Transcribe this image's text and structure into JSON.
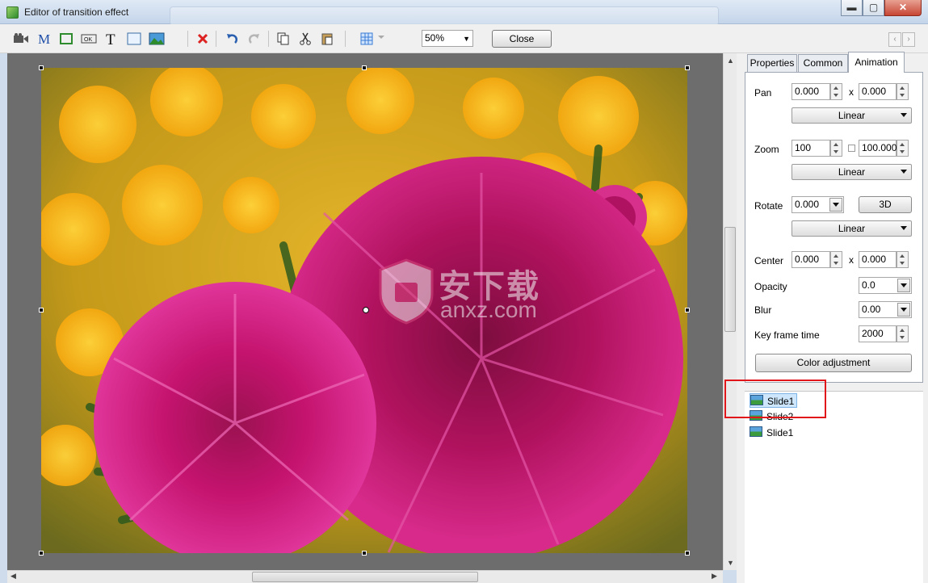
{
  "window": {
    "title": "Editor of transition effect",
    "minimize": "▬",
    "maximize": "▢",
    "close": "✕"
  },
  "toolbar": {
    "zoom_value": "50%",
    "close_label": "Close",
    "nav_prev": "‹",
    "nav_next": "›"
  },
  "tabs": {
    "properties": "Properties",
    "common": "Common",
    "animation": "Animation"
  },
  "animation": {
    "pan_label": "Pan",
    "pan_x": "0.000",
    "pan_sep": "x",
    "pan_y": "0.000",
    "pan_interp": "Linear",
    "zoom_label": "Zoom",
    "zoom_x": "100",
    "zoom_y": "100.000",
    "zoom_interp": "Linear",
    "rotate_label": "Rotate",
    "rotate_value": "0.000",
    "rotate_3d": "3D",
    "rotate_interp": "Linear",
    "center_label": "Center",
    "center_x": "0.000",
    "center_sep": "x",
    "center_y": "0.000",
    "opacity_label": "Opacity",
    "opacity_value": "0.0",
    "blur_label": "Blur",
    "blur_value": "0.00",
    "keyframe_label": "Key frame time",
    "keyframe_value": "2000",
    "color_adjustment": "Color adjustment"
  },
  "tree": {
    "items": [
      "Slide1",
      "Slide2",
      "Slide1"
    ]
  },
  "watermark": {
    "text": "安下载",
    "url": "anxz.com"
  },
  "icons": [
    "camera-icon",
    "text-m-icon",
    "rectangle-icon",
    "ok-button-icon",
    "text-t-icon",
    "frame-icon",
    "image-icon",
    "delete-icon",
    "undo-icon",
    "redo-icon",
    "copy-icon",
    "cut-icon",
    "paste-icon",
    "grid-icon"
  ]
}
